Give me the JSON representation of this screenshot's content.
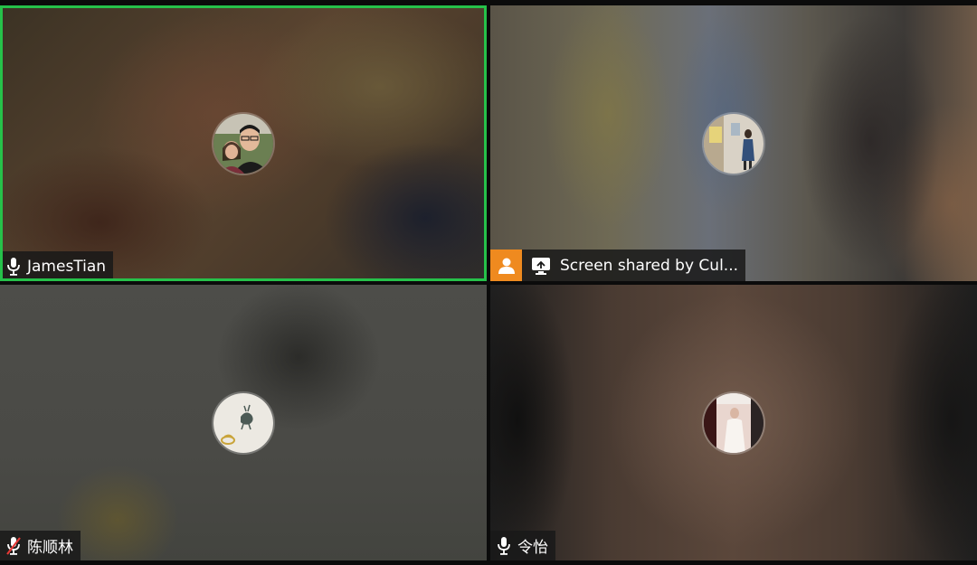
{
  "tiles": [
    {
      "name": "JamesTian",
      "mic": "mic-icon",
      "active_speaker": true,
      "accent": "#26c14a"
    },
    {
      "name": "Screen shared by Cul...",
      "mic": "mic-active-icon",
      "host_badge": "host-person-icon",
      "share": "screen-share-icon",
      "host_badge_color": "#ef8a1f",
      "mic_color": "#2ecc40"
    },
    {
      "name": "陈顺林",
      "mic": "mic-muted-icon",
      "mic_color": "#e53935"
    },
    {
      "name": "令怡",
      "mic": "mic-icon"
    }
  ]
}
